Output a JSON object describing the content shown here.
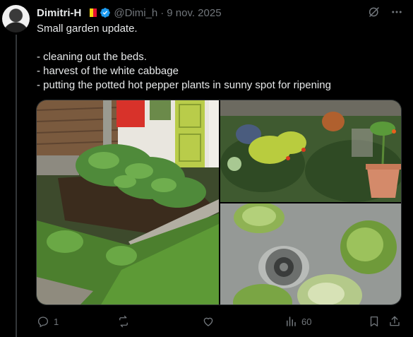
{
  "author": {
    "display_name": "Dimitri-H",
    "handle": "@Dimi_h",
    "separator": "·",
    "date": "9 nov. 2025",
    "flag_colors": [
      "#000000",
      "#f5d40f",
      "#e8102f"
    ]
  },
  "icons": {
    "verified": "verified-badge-icon",
    "grok": "grok-icon",
    "more": "more-icon",
    "reply": "reply-icon",
    "repost": "repost-icon",
    "like": "like-icon",
    "views": "views-icon",
    "bookmark": "bookmark-icon",
    "share": "share-icon"
  },
  "tweet": {
    "lines": [
      "Small garden update.",
      "",
      "- cleaning out the beds.",
      "- harvest of the white cabbage",
      "- putting the potted hot pepper plants in sunny spot for ripening"
    ]
  },
  "actions": {
    "reply_count": "1",
    "repost_count": "",
    "like_count": "",
    "views_count": "60"
  },
  "colors": {
    "background": "#000000",
    "text": "#e7e9ea",
    "muted": "#71767b",
    "verified": "#1d9bf0"
  }
}
